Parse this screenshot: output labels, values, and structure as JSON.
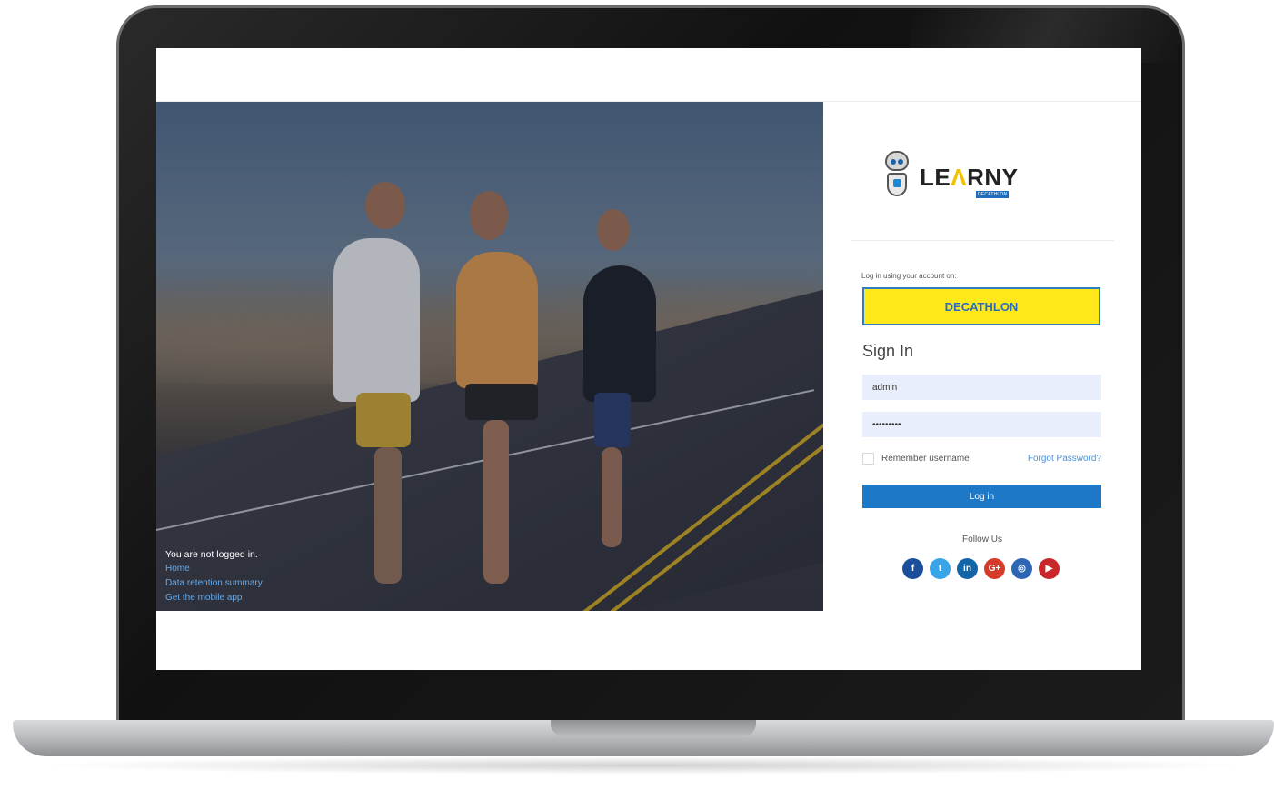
{
  "hero": {
    "status_text": "You are not logged in.",
    "links": [
      "Home",
      "Data retention summary",
      "Get the mobile app"
    ]
  },
  "logo": {
    "wordmark_left": "LE",
    "wordmark_mid": "Λ",
    "wordmark_right": "RNY",
    "sub": "DECATHLON"
  },
  "login": {
    "caption": "Log in using your account on:",
    "provider_button": "DECATHLON",
    "title": "Sign In",
    "username_value": "admin",
    "password_value": "•••••••••",
    "remember_label": "Remember username",
    "forgot_label": "Forgot Password?",
    "login_button": "Log in",
    "follow_label": "Follow Us"
  },
  "socials": [
    {
      "name": "facebook-icon",
      "glyph": "f",
      "color": "#1b4f9c"
    },
    {
      "name": "twitter-icon",
      "glyph": "t",
      "color": "#3aa4e8"
    },
    {
      "name": "linkedin-icon",
      "glyph": "in",
      "color": "#1464a8"
    },
    {
      "name": "google-plus-icon",
      "glyph": "G+",
      "color": "#d63a2a"
    },
    {
      "name": "instagram-icon",
      "glyph": "◎",
      "color": "#2f66b3"
    },
    {
      "name": "youtube-icon",
      "glyph": "▶",
      "color": "#c8262a"
    }
  ],
  "colors": {
    "accent_yellow": "#ffe81a",
    "primary_blue": "#1e78c8",
    "link_blue": "#67a9ea"
  }
}
